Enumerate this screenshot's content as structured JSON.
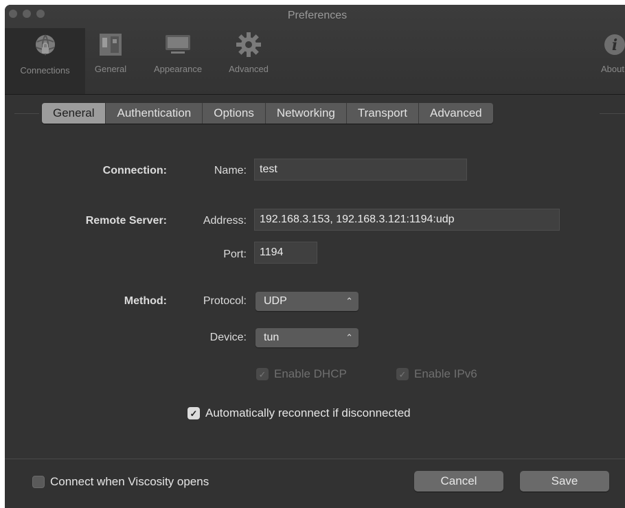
{
  "window": {
    "title": "Preferences"
  },
  "toolbar": {
    "items": [
      {
        "label": "Connections",
        "icon": "connections-globe-icon"
      },
      {
        "label": "General",
        "icon": "general-switches-icon"
      },
      {
        "label": "Appearance",
        "icon": "display-monitor-icon"
      },
      {
        "label": "Advanced",
        "icon": "gear-icon"
      },
      {
        "label": "About",
        "icon": "info-icon"
      }
    ]
  },
  "tabs": [
    "General",
    "Authentication",
    "Options",
    "Networking",
    "Transport",
    "Advanced"
  ],
  "selected_tab": "General",
  "connection": {
    "section": "Connection:",
    "name_label": "Name:",
    "name_value": "test"
  },
  "remote_server": {
    "section": "Remote Server:",
    "address_label": "Address:",
    "address_value": "192.168.3.153, 192.168.3.121:1194:udp",
    "port_label": "Port:",
    "port_value": "1194"
  },
  "method": {
    "section": "Method:",
    "protocol_label": "Protocol:",
    "protocol_value": "UDP",
    "device_label": "Device:",
    "device_value": "tun"
  },
  "options": {
    "enable_dhcp": {
      "label": "Enable DHCP",
      "checked": true,
      "disabled": true
    },
    "enable_ipv6": {
      "label": "Enable IPv6",
      "checked": true,
      "disabled": true
    },
    "auto_reconnect": {
      "label": "Automatically reconnect if disconnected",
      "checked": true
    }
  },
  "footer": {
    "connect_on_open": {
      "label": "Connect when Viscosity opens",
      "checked": false
    },
    "cancel_label": "Cancel",
    "save_label": "Save"
  },
  "colors": {
    "window_bg": "#323232",
    "tab_selected": "#9c9c9c",
    "tab_normal": "#595959",
    "field_bg": "#404040"
  }
}
